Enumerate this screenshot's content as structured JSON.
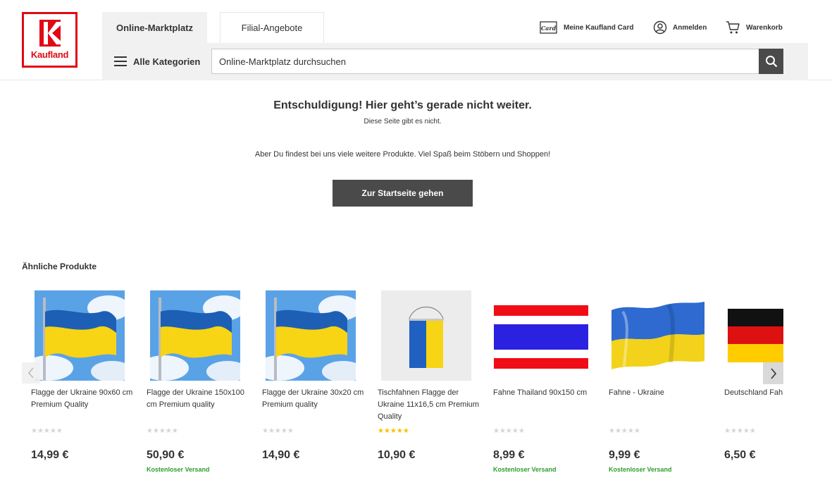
{
  "brand": {
    "name": "Kaufland",
    "color": "#e10915"
  },
  "tabs": [
    {
      "label": "Online-Marktplatz",
      "active": true
    },
    {
      "label": "Filial-Angebote",
      "active": false
    }
  ],
  "top_links": {
    "card": "Meine Kaufland Card",
    "card_icon_text": "Card",
    "login": "Anmelden",
    "cart": "Warenkorb"
  },
  "categories_label": "Alle Kategorien",
  "search": {
    "placeholder": "Online-Marktplatz durchsuchen"
  },
  "error": {
    "title": "Entschuldigung! Hier geht’s gerade nicht weiter.",
    "subtitle": "Diese Seite gibt es nicht.",
    "text": "Aber Du findest bei uns viele weitere Produkte. Viel Spaß beim Stöbern und Shoppen!",
    "button": "Zur Startseite gehen"
  },
  "similar": {
    "title": "Ähnliche Produkte",
    "products": [
      {
        "title": "Flagge der Ukraine 90x60 cm Premium Quality",
        "rating": 0,
        "price": "14,99 €",
        "shipping": "",
        "image": "ukraine-flag-sky-photo"
      },
      {
        "title": "Flagge der Ukraine 150x100 cm Premium quality",
        "rating": 0,
        "price": "50,90 €",
        "shipping": "Kostenloser Versand",
        "image": "ukraine-flag-sky-photo"
      },
      {
        "title": "Flagge der Ukraine 30x20 cm Premium quality",
        "rating": 0,
        "price": "14,90 €",
        "shipping": "",
        "image": "ukraine-flag-sky-photo"
      },
      {
        "title": "Tischfahnen Flagge der Ukraine 11x16,5 cm Premium Quality",
        "rating": 5,
        "price": "10,90 €",
        "shipping": "",
        "image": "ukraine-pennant"
      },
      {
        "title": "Fahne Thailand 90x150 cm",
        "rating": 0,
        "price": "8,99 €",
        "shipping": "Kostenloser Versand",
        "image": "thailand-flag"
      },
      {
        "title": "Fahne - Ukraine",
        "rating": 0,
        "price": "9,99 €",
        "shipping": "Kostenloser Versand",
        "image": "ukraine-flag-waving"
      },
      {
        "title": "Deutschland Fah",
        "rating": 0,
        "price": "6,50 €",
        "shipping": "",
        "image": "germany-flag"
      }
    ]
  },
  "colors": {
    "dark_button": "#4a4a4a",
    "shipping_green": "#2e9e2e",
    "star_gold": "#f5c200",
    "ukraine_blue": "#1d5fb5",
    "ukraine_yellow": "#f7d414"
  }
}
